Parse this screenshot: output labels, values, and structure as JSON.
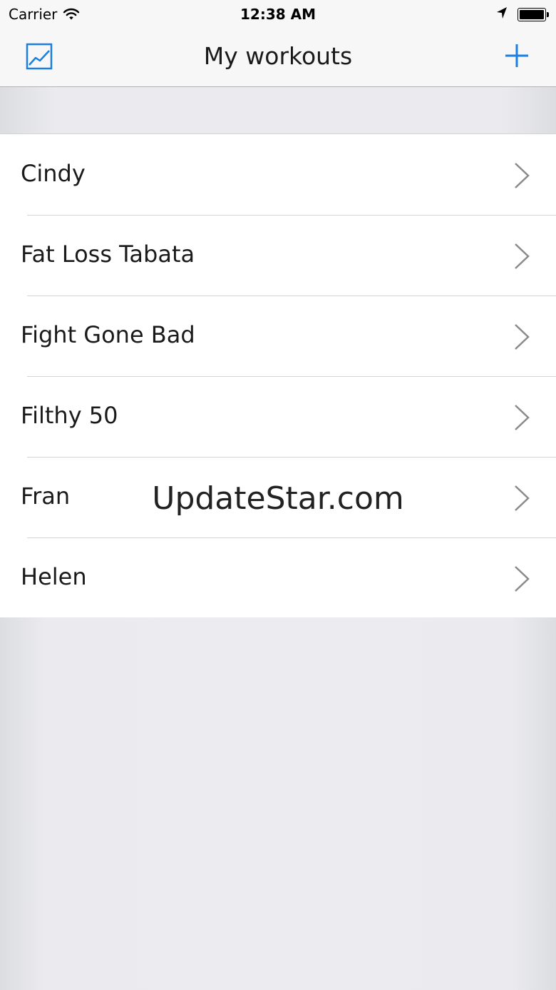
{
  "status_bar": {
    "carrier": "Carrier",
    "time": "12:38 AM",
    "icons": [
      "wifi-icon",
      "location-arrow-icon",
      "battery-icon"
    ]
  },
  "nav": {
    "title": "My workouts",
    "left_icon": "chart-icon",
    "right_icon": "plus-icon",
    "accent_color": "#1a7fe0"
  },
  "workouts": [
    {
      "name": "Cindy"
    },
    {
      "name": "Fat Loss Tabata"
    },
    {
      "name": "Fight Gone Bad"
    },
    {
      "name": "Filthy 50"
    },
    {
      "name": "Fran"
    },
    {
      "name": "Helen"
    }
  ],
  "watermark": "UpdateStar.com"
}
